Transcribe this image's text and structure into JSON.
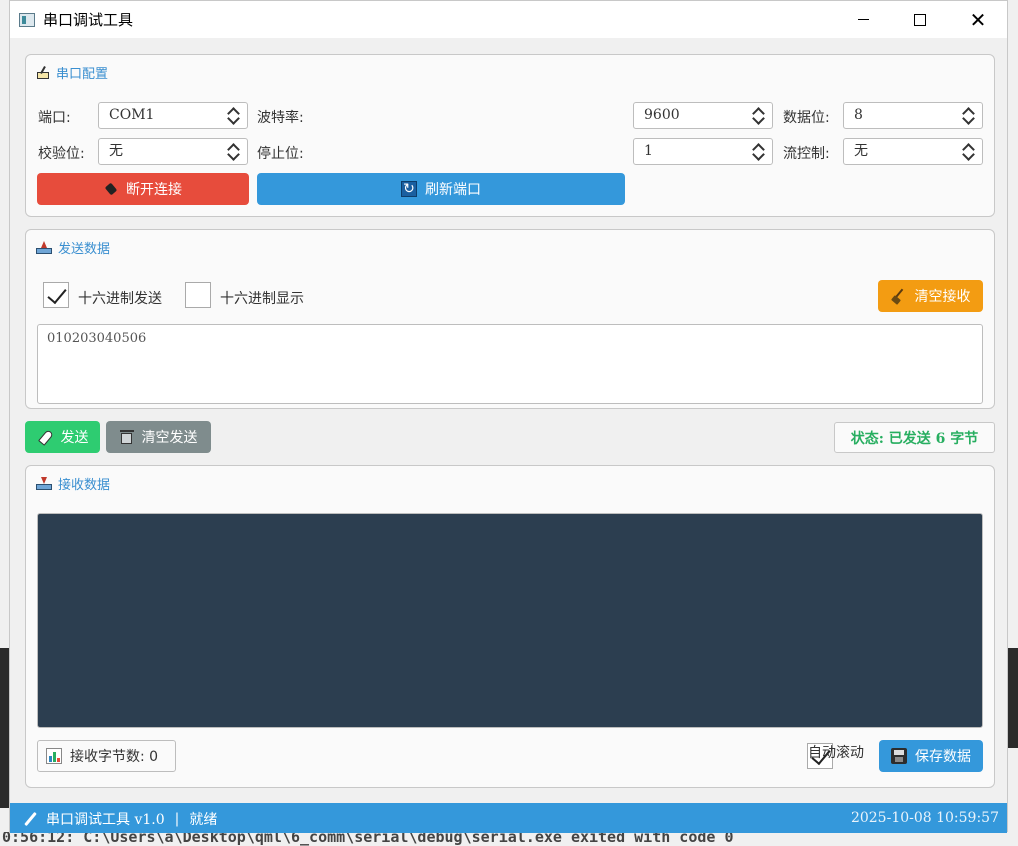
{
  "background": {
    "terminal_line": "0:56:12: C:\\Users\\a\\Desktop\\qml\\6_comm\\serial\\debug\\serial.exe exited with code 0"
  },
  "window": {
    "title": "串口调试工具",
    "controls": {
      "minimize": "—",
      "maximize": "☐",
      "close": "✕"
    }
  },
  "serial_config": {
    "title": "串口配置",
    "port_label": "端口:",
    "port_value": "COM1",
    "baud_label": "波特率:",
    "baud_value": "9600",
    "data_bits_label": "数据位:",
    "data_bits_value": "8",
    "parity_label": "校验位:",
    "parity_value": "无",
    "stop_bits_label": "停止位:",
    "stop_bits_value": "1",
    "flow_label": "流控制:",
    "flow_value": "无",
    "disconnect_label": "断开连接",
    "refresh_label": "刷新端口"
  },
  "send_data": {
    "title": "发送数据",
    "hex_send_label": "十六进制发送",
    "hex_send_checked": true,
    "hex_display_label": "十六进制显示",
    "hex_display_checked": false,
    "clear_receive_label": "清空接收",
    "input_value": "010203040506"
  },
  "actions": {
    "send_label": "发送",
    "clear_send_label": "清空发送",
    "status_text": "状态: 已发送 6 字节"
  },
  "receive_data": {
    "title": "接收数据",
    "content": "",
    "byte_count_text": "接收字节数: 0",
    "auto_scroll_label": "自动滚动",
    "auto_scroll_checked": true,
    "save_label": "保存数据"
  },
  "statusbar": {
    "app_name": "串口调试工具 v1.0",
    "separator": "|",
    "state": "就绪",
    "datetime": "2025-10-08 10:59:57"
  },
  "colors": {
    "accent": "#3498db",
    "danger": "#e74c3c",
    "warning": "#f39c12",
    "success": "#2ecc71",
    "neutral": "#7f8c8d",
    "receive_bg": "#2c3e50",
    "status_text": "#27ae60"
  }
}
